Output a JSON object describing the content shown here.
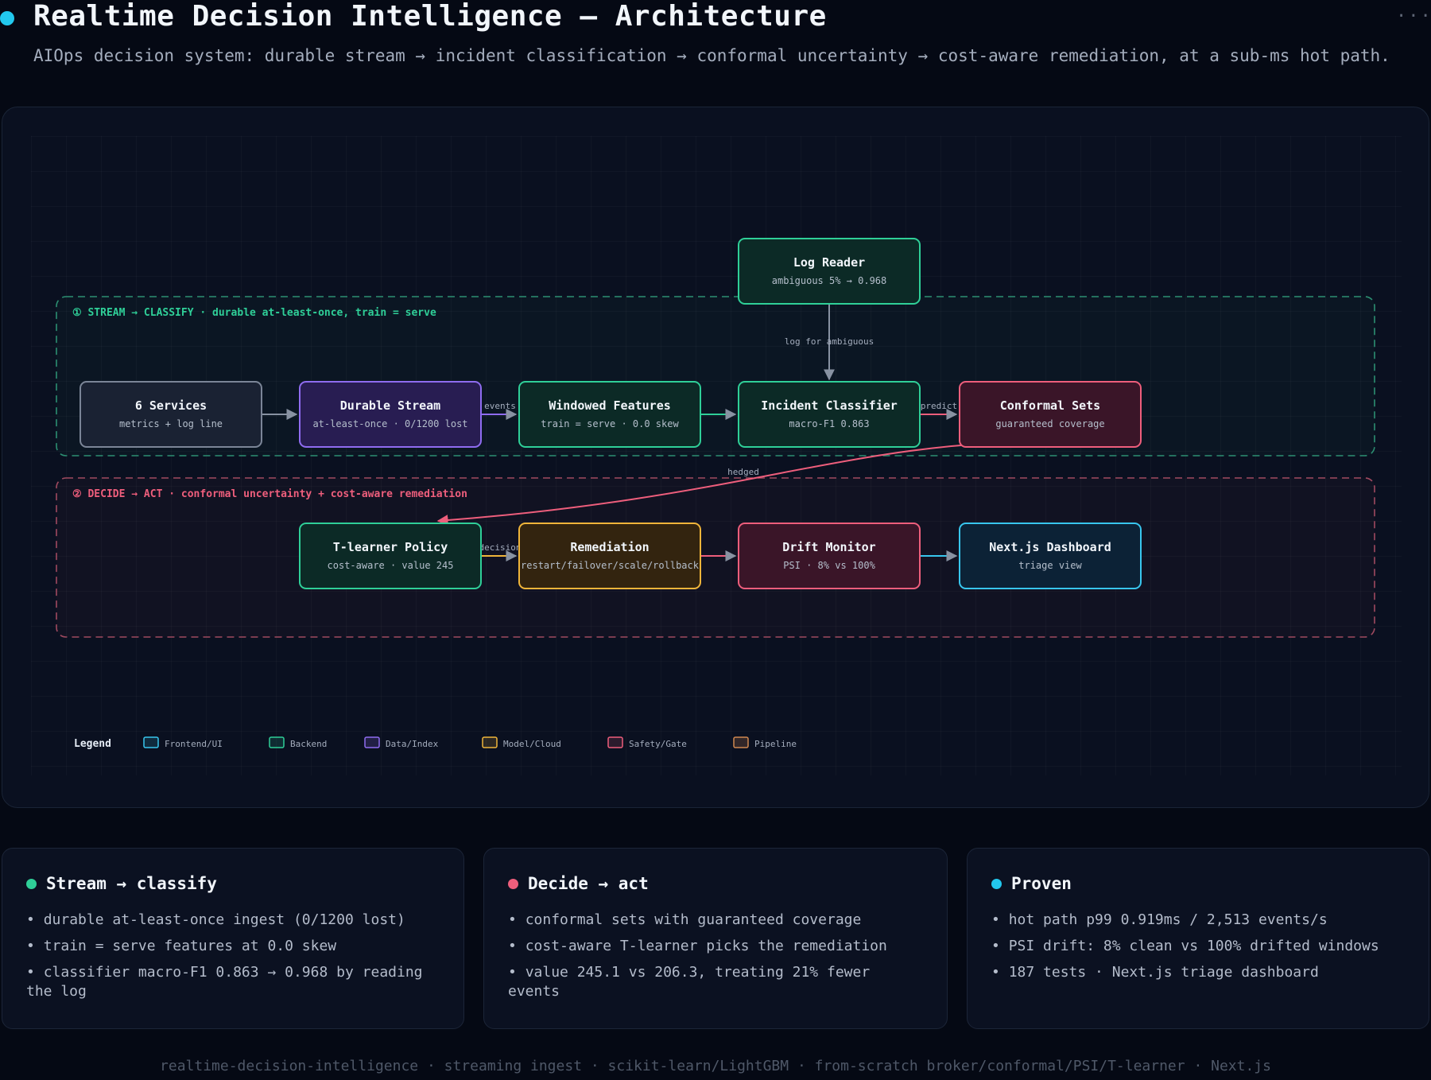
{
  "header": {
    "title": "Realtime Decision Intelligence — Architecture",
    "subtitle": "AIOps decision system: durable stream → incident classification → conformal uncertainty → cost-aware remediation, at a sub-ms hot path.",
    "menu_icon": "more-horizontal-icon"
  },
  "colors": {
    "frontend": "#38c6ee",
    "backend": "#2fcf98",
    "data": "#8f6cf0",
    "model": "#f0b53a",
    "safety": "#ee5e7c",
    "pipeline": "#d08850"
  },
  "diagram": {
    "groups": [
      {
        "id": "stream",
        "label": "① STREAM → CLASSIFY · durable at-least-once, train = serve",
        "kind": "backend"
      },
      {
        "id": "decide",
        "label": "② DECIDE → ACT · conformal uncertainty + cost-aware remediation",
        "kind": "safety"
      }
    ],
    "nodes": [
      {
        "id": "log-reader",
        "title": "Log Reader",
        "sub": "ambiguous 5% → 0.968",
        "kind": "backend"
      },
      {
        "id": "services",
        "title": "6 Services",
        "sub": "metrics + log line",
        "kind": "neutral"
      },
      {
        "id": "stream",
        "title": "Durable Stream",
        "sub": "at-least-once · 0/1200 lost",
        "kind": "data"
      },
      {
        "id": "features",
        "title": "Windowed Features",
        "sub": "train = serve · 0.0 skew",
        "kind": "backend"
      },
      {
        "id": "classifier",
        "title": "Incident Classifier",
        "sub": "macro-F1 0.863",
        "kind": "backend"
      },
      {
        "id": "conformal",
        "title": "Conformal Sets",
        "sub": "guaranteed coverage",
        "kind": "safety"
      },
      {
        "id": "policy",
        "title": "T-learner Policy",
        "sub": "cost-aware · value 245",
        "kind": "backend"
      },
      {
        "id": "remediation",
        "title": "Remediation",
        "sub": "restart/failover/scale/rollback",
        "kind": "model"
      },
      {
        "id": "drift",
        "title": "Drift Monitor",
        "sub": "PSI · 8% vs 100%",
        "kind": "safety"
      },
      {
        "id": "dashboard",
        "title": "Next.js Dashboard",
        "sub": "triage view",
        "kind": "frontend"
      }
    ],
    "edge_labels": {
      "log": "log for ambiguous",
      "events": "events",
      "predict": "predict",
      "hedged": "hedged",
      "decision": "decision"
    },
    "legend": {
      "title": "Legend",
      "items": [
        {
          "label": "Frontend/UI",
          "kind": "frontend"
        },
        {
          "label": "Backend",
          "kind": "backend"
        },
        {
          "label": "Data/Index",
          "kind": "data"
        },
        {
          "label": "Model/Cloud",
          "kind": "model"
        },
        {
          "label": "Safety/Gate",
          "kind": "safety"
        },
        {
          "label": "Pipeline",
          "kind": "pipeline"
        }
      ]
    }
  },
  "cards": [
    {
      "title": "Stream → classify",
      "dot": "#2fcf98",
      "items": [
        "durable at-least-once ingest (0/1200 lost)",
        "train = serve features at 0.0 skew",
        "classifier macro-F1 0.863 → 0.968 by reading the log"
      ]
    },
    {
      "title": "Decide → act",
      "dot": "#ee5e7c",
      "items": [
        "conformal sets with guaranteed coverage",
        "cost-aware T-learner picks the remediation",
        "value 245.1 vs 206.3, treating 21% fewer events"
      ]
    },
    {
      "title": "Proven",
      "dot": "#22c8ee",
      "items": [
        "hot path p99 0.919ms / 2,513 events/s",
        "PSI drift: 8% clean vs 100% drifted windows",
        "187 tests · Next.js triage dashboard"
      ]
    }
  ],
  "footer": "realtime-decision-intelligence · streaming ingest · scikit-learn/LightGBM · from-scratch broker/conformal/PSI/T-learner · Next.js"
}
